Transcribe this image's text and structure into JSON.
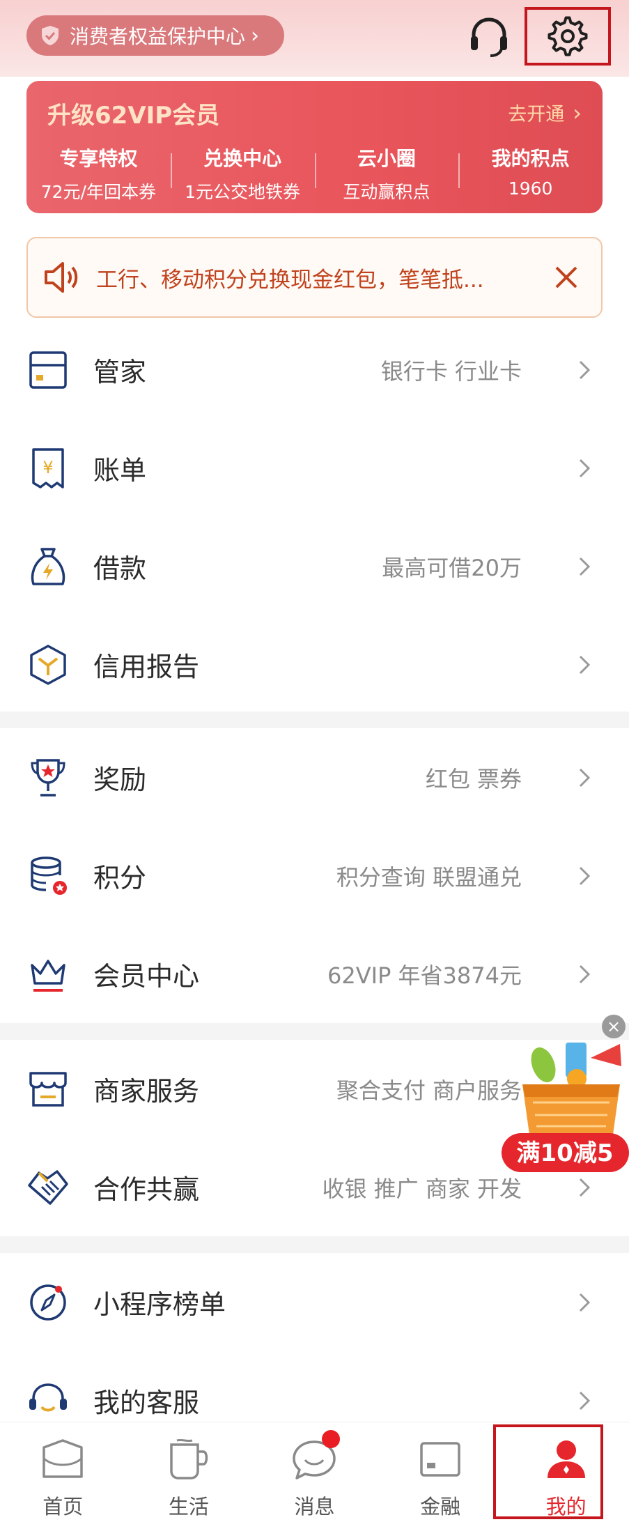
{
  "header": {
    "consumer_center": "消费者权益保护中心"
  },
  "vip": {
    "title": "升级62VIP会员",
    "open_label": "去开通",
    "items": [
      {
        "title": "专享特权",
        "sub": "72元/年回本券"
      },
      {
        "title": "兑换中心",
        "sub": "1元公交地铁券"
      },
      {
        "title": "云小圈",
        "sub": "互动赢积点"
      },
      {
        "title": "我的积点",
        "sub": "1960"
      }
    ]
  },
  "notice": {
    "text": "工行、移动积分兑换现金红包，笔笔抵..."
  },
  "groups": [
    [
      {
        "label": "管家",
        "sub": "银行卡 行业卡",
        "icon": "card-icon"
      },
      {
        "label": "账单",
        "sub": "",
        "icon": "bill-icon"
      },
      {
        "label": "借款",
        "sub": "最高可借20万",
        "icon": "loan-bag-icon"
      },
      {
        "label": "信用报告",
        "sub": "",
        "icon": "credit-report-icon"
      }
    ],
    [
      {
        "label": "奖励",
        "sub": "红包 票券",
        "icon": "trophy-icon"
      },
      {
        "label": "积分",
        "sub": "积分查询 联盟通兑",
        "icon": "coins-icon"
      },
      {
        "label": "会员中心",
        "sub": "62VIP 年省3874元",
        "icon": "crown-icon"
      }
    ],
    [
      {
        "label": "商家服务",
        "sub": "聚合支付 商户服务",
        "icon": "store-icon"
      },
      {
        "label": "合作共赢",
        "sub": "收银 推广 商家 开发",
        "icon": "handshake-icon"
      }
    ],
    [
      {
        "label": "小程序榜单",
        "sub": "",
        "icon": "compass-icon"
      },
      {
        "label": "我的客服",
        "sub": "",
        "icon": "service-icon"
      }
    ]
  ],
  "promo": {
    "label": "满10减5"
  },
  "tabbar": {
    "tabs": [
      {
        "label": "首页"
      },
      {
        "label": "生活"
      },
      {
        "label": "消息"
      },
      {
        "label": "金融"
      },
      {
        "label": "我的"
      }
    ]
  }
}
